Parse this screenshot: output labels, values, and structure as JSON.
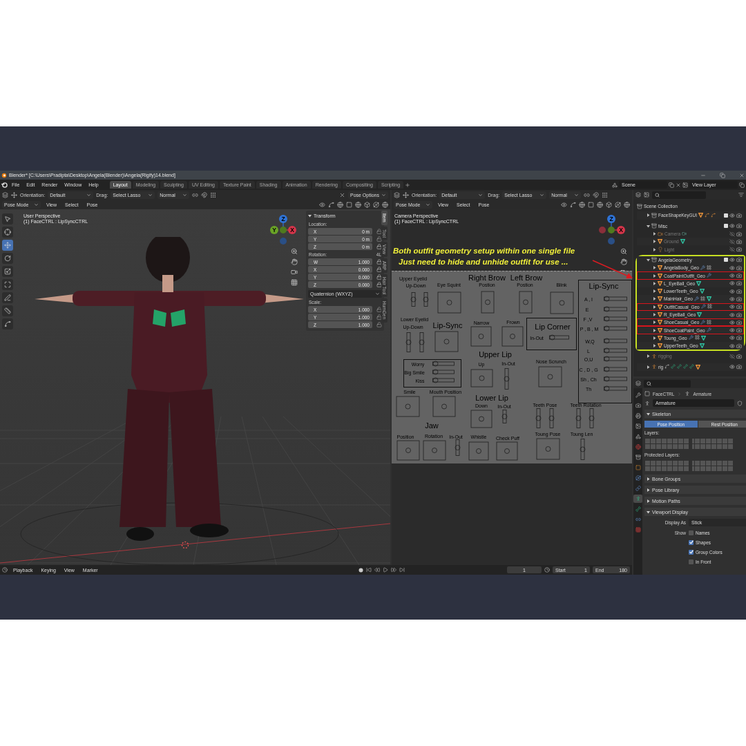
{
  "title_bar": {
    "title": "Blender* [C:\\Users\\Pradipta\\Desktop\\Angela(Blender)\\Angela(Rigify)14.blend]"
  },
  "menu": [
    "File",
    "Edit",
    "Render",
    "Window",
    "Help"
  ],
  "workspaces": [
    {
      "label": "Layout",
      "selected": true
    },
    {
      "label": "Modeling",
      "selected": false
    },
    {
      "label": "Sculpting",
      "selected": false
    },
    {
      "label": "UV Editing",
      "selected": false
    },
    {
      "label": "Texture Paint",
      "selected": false
    },
    {
      "label": "Shading",
      "selected": false
    },
    {
      "label": "Animation",
      "selected": false
    },
    {
      "label": "Rendering",
      "selected": false
    },
    {
      "label": "Compositing",
      "selected": false
    },
    {
      "label": "Scripting",
      "selected": false
    }
  ],
  "scene": "Scene",
  "view_layer": "View Layer",
  "left_viewport": {
    "header": {
      "orientation_label": "Orientation:",
      "orientation": "Default",
      "drag_label": "Drag:",
      "drag": "Select Lasso",
      "pivot": "Normal",
      "options": "Pose Options"
    },
    "mode": "Pose Mode",
    "menus": [
      "View",
      "Select",
      "Pose"
    ],
    "info": [
      "User Perspective",
      "(1) FaceCTRL : LipSyncCTRL"
    ],
    "gizmo": [
      {
        "label": "Z",
        "color": "#2f73d6"
      },
      {
        "label": "Y",
        "color": "#6aa426"
      },
      {
        "label": "X",
        "color": "#d6354a"
      }
    ],
    "tools": [
      {
        "kind": "select",
        "selected": false
      },
      {
        "kind": "cursor",
        "selected": false
      },
      {
        "kind": "move",
        "selected": true
      },
      {
        "kind": "rotate",
        "selected": false
      },
      {
        "kind": "scale",
        "selected": false
      },
      {
        "kind": "transform",
        "selected": false
      },
      {
        "kind": "annotate",
        "selected": false
      },
      {
        "kind": "measure",
        "selected": false
      },
      {
        "kind": "curve",
        "selected": false
      }
    ],
    "sidebar_tabs": [
      {
        "label": "Item",
        "selected": true
      },
      {
        "label": "Tool",
        "selected": false
      },
      {
        "label": "View",
        "selected": false
      },
      {
        "label": "ARP",
        "selected": false
      },
      {
        "label": "Hair Tool",
        "selected": false
      },
      {
        "label": "HumGen",
        "selected": false
      }
    ],
    "transform": {
      "title": "Transform",
      "location": {
        "label": "Location:",
        "rows": [
          {
            "axis": "X",
            "value": "0 m",
            "locked": false
          },
          {
            "axis": "Y",
            "value": "0 m",
            "locked": false
          },
          {
            "axis": "Z",
            "value": "0 m",
            "locked": true
          }
        ]
      },
      "rotation": {
        "label": "Rotation:",
        "note": "4L",
        "rows": [
          {
            "axis": "W",
            "value": "1.000",
            "locked": true
          },
          {
            "axis": "X",
            "value": "0.000",
            "locked": true
          },
          {
            "axis": "Y",
            "value": "0.000",
            "locked": true
          },
          {
            "axis": "Z",
            "value": "0.000",
            "locked": true
          }
        ]
      },
      "rotation_mode": "Quaternion (WXYZ)",
      "scale": {
        "label": "Scale:",
        "rows": [
          {
            "axis": "X",
            "value": "1.000",
            "locked": false
          },
          {
            "axis": "Y",
            "value": "1.000",
            "locked": false
          },
          {
            "axis": "Z",
            "value": "1.000",
            "locked": false
          }
        ]
      }
    }
  },
  "right_viewport": {
    "header": {
      "orientation_label": "Orientation:",
      "orientation": "Default",
      "drag_label": "Drag:",
      "drag": "Select Lasso",
      "pivot": "Normal"
    },
    "mode": "Pose Mode",
    "menus": [
      "View",
      "Select",
      "Pose"
    ],
    "info": [
      "Camera Perspective",
      "(1) FaceCTRL : LipSyncCTRL"
    ],
    "gizmo": [
      {
        "label": "Z",
        "color": "#2f73d6"
      },
      {
        "label": "X",
        "color": "#d6354a"
      }
    ],
    "annotation": [
      "Both outfit geometry setup within one single file",
      "Just need to hide and unhide outfit for use ..."
    ],
    "face_rig": [
      {
        "text": "Upper Eyelid",
        "kind": "label"
      },
      {
        "text": "Up-Down",
        "kind": "label"
      },
      {
        "text": "Eye Squint",
        "kind": "label"
      },
      {
        "text": "Right Brow",
        "kind": "title"
      },
      {
        "text": "Postion",
        "kind": "label"
      },
      {
        "text": "Left Brow",
        "kind": "title"
      },
      {
        "text": "Postion",
        "kind": "label"
      },
      {
        "text": "Blink",
        "kind": "label"
      },
      {
        "text": "Lip-Sync",
        "kind": "title"
      },
      {
        "text": "A , I",
        "kind": "label"
      },
      {
        "text": "E",
        "kind": "label"
      },
      {
        "text": "F ,V",
        "kind": "label"
      },
      {
        "text": "P , B , M",
        "kind": "label"
      },
      {
        "text": "W,Q",
        "kind": "label"
      },
      {
        "text": "L",
        "kind": "label"
      },
      {
        "text": "O,U",
        "kind": "label"
      },
      {
        "text": "C , D , G",
        "kind": "label"
      },
      {
        "text": "Sh , Ch",
        "kind": "label"
      },
      {
        "text": "Th",
        "kind": "label"
      },
      {
        "text": "Lower Eyelid",
        "kind": "label"
      },
      {
        "text": "Up-Down",
        "kind": "label"
      },
      {
        "text": "Lip-Sync",
        "kind": "title"
      },
      {
        "text": "Narrow",
        "kind": "label"
      },
      {
        "text": "Frown",
        "kind": "label"
      },
      {
        "text": "Lip Corner",
        "kind": "title"
      },
      {
        "text": "In-Out",
        "kind": "label"
      },
      {
        "text": "Upper Lip",
        "kind": "title"
      },
      {
        "text": "Up",
        "kind": "label"
      },
      {
        "text": "In-Out",
        "kind": "label"
      },
      {
        "text": "Nose Scrunch",
        "kind": "label"
      },
      {
        "text": "Worry",
        "kind": "label"
      },
      {
        "text": "Big Smile",
        "kind": "label"
      },
      {
        "text": "Kiss",
        "kind": "label"
      },
      {
        "text": "Smile",
        "kind": "label"
      },
      {
        "text": "Mouth Position",
        "kind": "label"
      },
      {
        "text": "Lower Lip",
        "kind": "title"
      },
      {
        "text": "Down",
        "kind": "label"
      },
      {
        "text": "In-Out",
        "kind": "label"
      },
      {
        "text": "Teeth Pose",
        "kind": "label"
      },
      {
        "text": "Teeth Rotation",
        "kind": "label"
      },
      {
        "text": "Jaw",
        "kind": "title"
      },
      {
        "text": "Position",
        "kind": "label"
      },
      {
        "text": "Rotation",
        "kind": "label"
      },
      {
        "text": "In-Out",
        "kind": "label"
      },
      {
        "text": "Whistle",
        "kind": "label"
      },
      {
        "text": "Check Puff",
        "kind": "label"
      },
      {
        "text": "Toung Pose",
        "kind": "label"
      },
      {
        "text": "Toung Len",
        "kind": "label"
      }
    ]
  },
  "outliner": {
    "items": [
      {
        "name": "Scene Collection",
        "kind": "scene",
        "children": [
          {
            "name": "FaceShapeKeyGUI",
            "kind": "collection",
            "expanded": false,
            "checked": true,
            "visible": true,
            "disabled": false,
            "highlighted": false,
            "circled": false,
            "icons": [
              {
                "kind": "mesh"
              },
              {
                "kind": "curve"
              },
              {
                "kind": "curve"
              }
            ]
          },
          {
            "name": "Misc",
            "kind": "collection",
            "expanded": true,
            "checked": true,
            "visible": true,
            "disabled": false,
            "highlighted": false,
            "circled": false,
            "children": [
              {
                "name": "Camera",
                "kind": "camera",
                "expanded": false,
                "visible": false,
                "disabled": true,
                "highlighted": false,
                "icons": [
                  {
                    "kind": "camera"
                  }
                ]
              },
              {
                "name": "Ground",
                "kind": "mesh",
                "expanded": false,
                "visible": false,
                "disabled": true,
                "highlighted": false,
                "icons": [
                  {
                    "kind": "mesh-data"
                  }
                ]
              },
              {
                "name": "Light",
                "kind": "light",
                "expanded": false,
                "visible": false,
                "disabled": true,
                "highlighted": false
              }
            ]
          },
          {
            "name": "AngelaGeometry",
            "kind": "collection",
            "expanded": true,
            "checked": true,
            "visible": true,
            "disabled": false,
            "highlighted": false,
            "circled": true,
            "children": [
              {
                "name": "AngelaBody_Geo",
                "kind": "mesh",
                "expanded": false,
                "visible": true,
                "disabled": false,
                "highlighted": false,
                "icons": [
                  {
                    "kind": "wrench"
                  },
                  {
                    "kind": "grid"
                  }
                ]
              },
              {
                "name": "CoatPaintOutfit_Geo",
                "kind": "mesh",
                "expanded": false,
                "visible": true,
                "disabled": false,
                "highlighted": true,
                "icons": [
                  {
                    "kind": "wrench"
                  }
                ]
              },
              {
                "name": "L_EyeBall_Geo",
                "kind": "mesh",
                "expanded": false,
                "visible": true,
                "disabled": false,
                "highlighted": false,
                "icons": [
                  {
                    "kind": "mesh-data"
                  }
                ]
              },
              {
                "name": "LowerTeeth_Geo",
                "kind": "mesh",
                "expanded": false,
                "visible": true,
                "disabled": false,
                "highlighted": false,
                "icons": [
                  {
                    "kind": "mesh-data"
                  }
                ]
              },
              {
                "name": "MainHair_Geo",
                "kind": "mesh",
                "expanded": false,
                "visible": true,
                "disabled": false,
                "highlighted": false,
                "icons": [
                  {
                    "kind": "wrench"
                  },
                  {
                    "kind": "grid"
                  },
                  {
                    "kind": "mesh-data"
                  }
                ]
              },
              {
                "name": "OutfitCasual_Geo",
                "kind": "mesh",
                "expanded": false,
                "visible": true,
                "disabled": false,
                "highlighted": true,
                "icons": [
                  {
                    "kind": "wrench"
                  },
                  {
                    "kind": "grid"
                  }
                ]
              },
              {
                "name": "R_EyeBall_Geo",
                "kind": "mesh",
                "expanded": false,
                "visible": true,
                "disabled": false,
                "highlighted": false,
                "icons": [
                  {
                    "kind": "mesh-data"
                  }
                ]
              },
              {
                "name": "ShoeCasual_Geo",
                "kind": "mesh",
                "expanded": false,
                "visible": true,
                "disabled": false,
                "highlighted": true,
                "icons": [
                  {
                    "kind": "wrench"
                  },
                  {
                    "kind": "grid"
                  }
                ]
              },
              {
                "name": "ShoeCoatPaint_Geo",
                "kind": "mesh",
                "expanded": false,
                "visible": true,
                "disabled": false,
                "highlighted": true,
                "icons": [
                  {
                    "kind": "wrench"
                  }
                ]
              },
              {
                "name": "Toung_Geo",
                "kind": "mesh",
                "expanded": false,
                "visible": true,
                "disabled": false,
                "highlighted": false,
                "icons": [
                  {
                    "kind": "wrench"
                  },
                  {
                    "kind": "grid"
                  },
                  {
                    "kind": "mesh-data"
                  }
                ]
              },
              {
                "name": "UpperTeeth_Geo",
                "kind": "mesh",
                "expanded": false,
                "visible": true,
                "disabled": false,
                "highlighted": false,
                "icons": [
                  {
                    "kind": "mesh-data"
                  }
                ]
              }
            ]
          },
          {
            "name": "rigging",
            "kind": "armature",
            "expanded": false,
            "visible": false,
            "disabled": true,
            "highlighted": false,
            "circled": false
          },
          {
            "name": "rig",
            "kind": "armature",
            "expanded": false,
            "visible": true,
            "disabled": false,
            "highlighted": false,
            "circled": false,
            "icons": [
              {
                "kind": "pose"
              },
              {
                "kind": "bone"
              },
              {
                "kind": "bone"
              },
              {
                "kind": "bone"
              },
              {
                "kind": "bone"
              },
              {
                "kind": "mesh"
              }
            ]
          }
        ]
      }
    ]
  },
  "properties": {
    "tabs": [
      {
        "kind": "tool",
        "selected": false
      },
      {
        "kind": "render",
        "selected": false
      },
      {
        "kind": "output",
        "selected": false
      },
      {
        "kind": "view-layer",
        "selected": false
      },
      {
        "kind": "scene",
        "selected": false
      },
      {
        "kind": "world",
        "selected": false
      },
      {
        "kind": "collection",
        "selected": false
      },
      {
        "kind": "object",
        "selected": false
      },
      {
        "kind": "physics",
        "selected": false
      },
      {
        "kind": "constraints",
        "selected": false
      },
      {
        "kind": "data",
        "selected": true
      },
      {
        "kind": "bone",
        "selected": false
      },
      {
        "kind": "bone-constraints",
        "selected": false
      },
      {
        "kind": "texture",
        "selected": false
      }
    ],
    "object": "FaceCTRL",
    "data": "Armature",
    "data_field": "Armature",
    "skeleton": {
      "title": "Skeleton",
      "expanded": true,
      "positions": [
        {
          "label": "Pose Position",
          "selected": true
        },
        {
          "label": "Rest Position",
          "selected": false
        }
      ],
      "layers_label": "Layers:",
      "protected_label": "Protected Layers:"
    },
    "sections": [
      {
        "title": "Bone Groups",
        "expanded": false
      },
      {
        "title": "Pose Library",
        "expanded": false
      },
      {
        "title": "Motion Paths",
        "expanded": false
      },
      {
        "title": "Viewport Display",
        "expanded": true
      }
    ],
    "display": {
      "display_as_label": "Display As",
      "display_as": "Stick",
      "show_label": "Show",
      "options": [
        {
          "label": "Names",
          "checked": false
        },
        {
          "label": "Shapes",
          "checked": true
        },
        {
          "label": "Group Colors",
          "checked": true
        },
        {
          "label": "In Front",
          "checked": false
        }
      ]
    }
  },
  "timeline": {
    "menus": [
      "Playback",
      "Keying",
      "View",
      "Marker"
    ],
    "frame": "1",
    "start_label": "Start",
    "start": "1",
    "end_label": "End",
    "end": "180"
  }
}
